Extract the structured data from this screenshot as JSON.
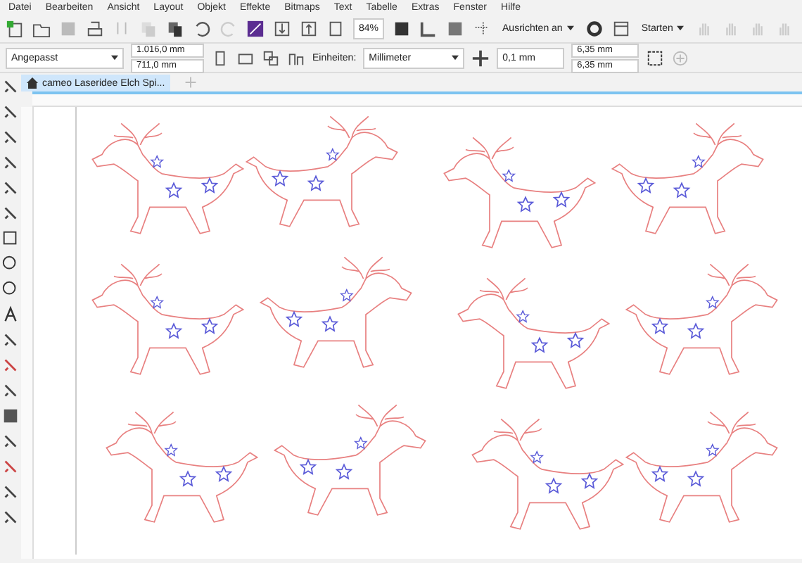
{
  "menu": [
    "Datei",
    "Bearbeiten",
    "Ansicht",
    "Layout",
    "Objekt",
    "Effekte",
    "Bitmaps",
    "Text",
    "Tabelle",
    "Extras",
    "Fenster",
    "Hilfe"
  ],
  "toolbar": {
    "zoom": "84%",
    "snap": "Ausrichten an",
    "launch": "Starten"
  },
  "property_bar": {
    "preset": "Angepasst",
    "width": "1.016,0 mm",
    "height": "711,0 mm",
    "units_label": "Einheiten:",
    "units": "Millimeter",
    "nudge": "0,1 mm",
    "duplicate_x": "6,35 mm",
    "duplicate_y": "6,35 mm"
  },
  "tabs": [
    {
      "label": "cameo Laseridee Elch Spi...",
      "selected": true
    }
  ]
}
